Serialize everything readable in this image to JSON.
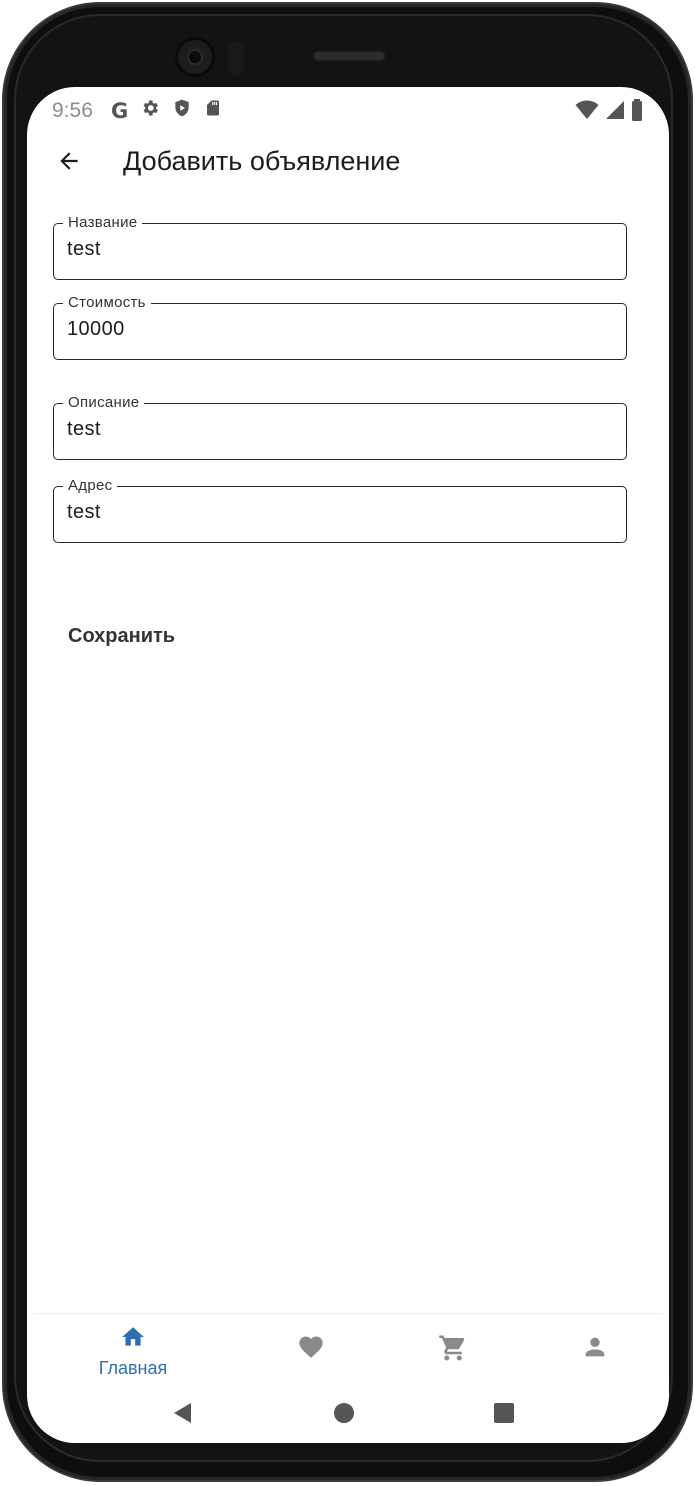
{
  "status_bar": {
    "time": "9:56",
    "icons": [
      "google-icon",
      "settings-icon",
      "shield-play-icon",
      "sd-card-icon",
      "wifi-icon",
      "signal-icon",
      "battery-icon"
    ],
    "google_letter": "G"
  },
  "app_bar": {
    "title": "Добавить объявление",
    "back_icon": "arrow-back-icon"
  },
  "form": {
    "fields": [
      {
        "label": "Название",
        "value": "test"
      },
      {
        "label": "Стоимость",
        "value": "10000"
      },
      {
        "label": "Описание",
        "value": "test"
      },
      {
        "label": "Адрес",
        "value": "test"
      }
    ],
    "save_label": "Сохранить"
  },
  "bottom_nav": {
    "items": [
      {
        "label": "Главная",
        "icon": "home-icon",
        "active": true
      },
      {
        "label": "",
        "icon": "heart-icon",
        "active": false
      },
      {
        "label": "",
        "icon": "cart-icon",
        "active": false
      },
      {
        "label": "",
        "icon": "person-icon",
        "active": false
      }
    ]
  },
  "system_nav": {
    "icons": [
      "back-triangle-icon",
      "home-circle-icon",
      "recents-square-icon"
    ]
  },
  "colors": {
    "accent": "#2e6fb0",
    "inactive_icon": "#8a8a8a",
    "text": "#1c1c1c",
    "outline": "#2a2a2a",
    "background": "#ffffff"
  }
}
